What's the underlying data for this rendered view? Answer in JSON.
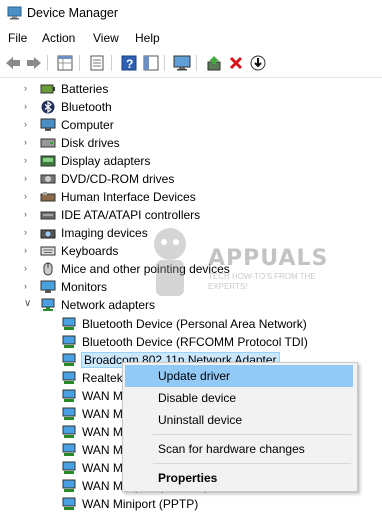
{
  "window": {
    "title": "Device Manager"
  },
  "menu": [
    "File",
    "Action",
    "View",
    "Help"
  ],
  "toolbar": [
    "back-arrow-icon",
    "forward-arrow-icon",
    "properties-grid-icon",
    "details-icon",
    "help-icon",
    "details-pane-icon",
    "monitor-scan-icon",
    "update-driver-icon",
    "uninstall-x-icon",
    "disable-download-icon"
  ],
  "tree": {
    "categories": [
      {
        "label": "Batteries",
        "icon": "battery-icon"
      },
      {
        "label": "Bluetooth",
        "icon": "bluetooth-icon"
      },
      {
        "label": "Computer",
        "icon": "computer-icon"
      },
      {
        "label": "Disk drives",
        "icon": "disk-icon"
      },
      {
        "label": "Display adapters",
        "icon": "display-icon"
      },
      {
        "label": "DVD/CD-ROM drives",
        "icon": "dvd-icon"
      },
      {
        "label": "Human Interface Devices",
        "icon": "hid-icon"
      },
      {
        "label": "IDE ATA/ATAPI controllers",
        "icon": "ide-icon"
      },
      {
        "label": "Imaging devices",
        "icon": "camera-icon"
      },
      {
        "label": "Keyboards",
        "icon": "keyboard-icon"
      },
      {
        "label": "Mice and other pointing devices",
        "icon": "mouse-icon"
      },
      {
        "label": "Monitors",
        "icon": "monitor-icon"
      },
      {
        "label": "Network adapters",
        "icon": "network-icon"
      }
    ],
    "network_children": [
      {
        "label": "Bluetooth Device (Personal Area Network)"
      },
      {
        "label": "Bluetooth Device (RFCOMM Protocol TDI)"
      },
      {
        "label": "Broadcom 802.11n Network Adapter"
      },
      {
        "label": "Realtek"
      },
      {
        "label": "WAN M"
      },
      {
        "label": "WAN M"
      },
      {
        "label": "WAN M"
      },
      {
        "label": "WAN M"
      },
      {
        "label": "WAN M"
      },
      {
        "label": "WAN Miniport (PPPOE)"
      },
      {
        "label": "WAN Miniport (PPTP)"
      }
    ]
  },
  "context_menu": {
    "items": [
      "Update driver",
      "Disable device",
      "Uninstall device",
      "Scan for hardware changes",
      "Properties"
    ]
  },
  "watermark": {
    "brand": "APPUALS",
    "tagline": "TECH HOW-TO'S FROM THE EXPERTS!"
  }
}
